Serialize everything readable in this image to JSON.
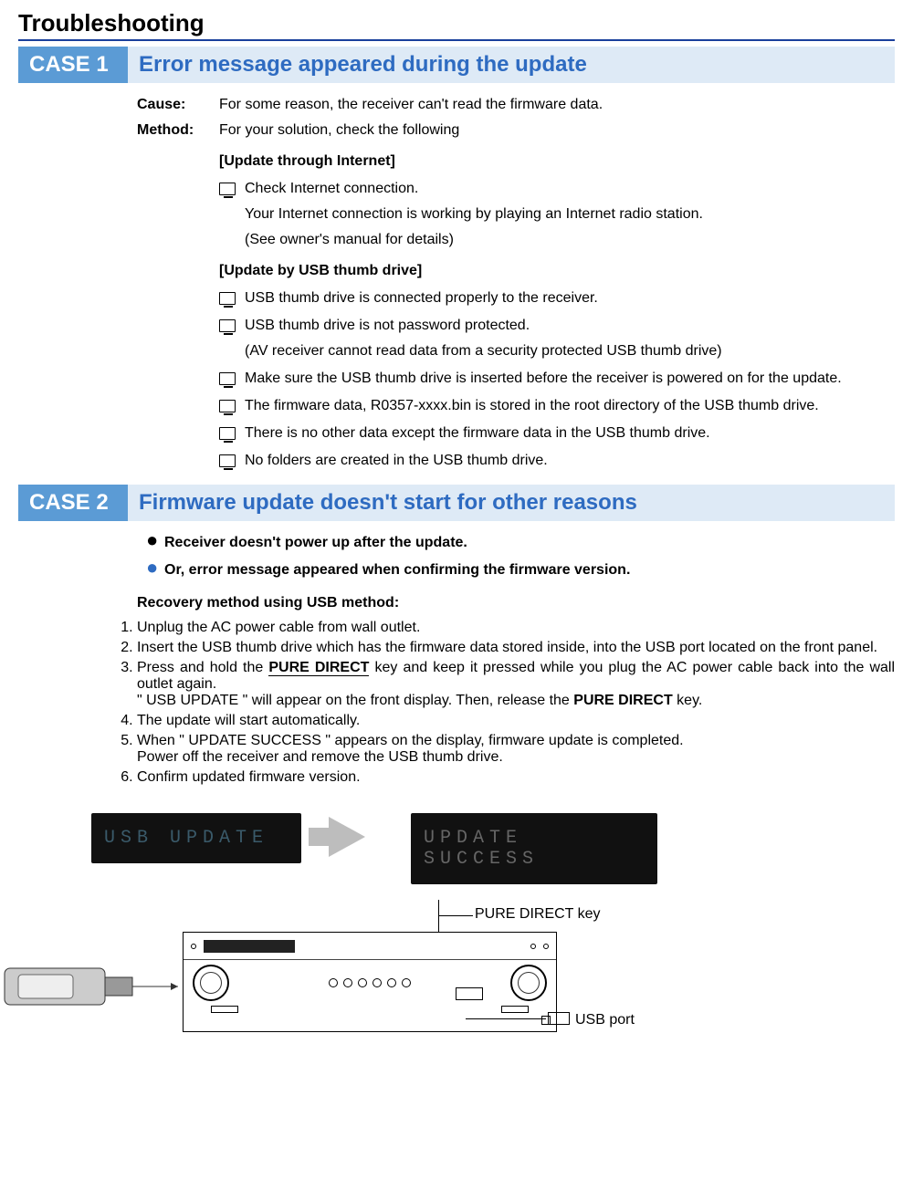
{
  "title": "Troubleshooting",
  "case1": {
    "badge": "CASE 1",
    "title": "Error message appeared during the update",
    "cause_label": "Cause:",
    "cause_text": "For some reason, the receiver can't read the firmware data.",
    "method_label": "Method:",
    "method_text": "For your solution, check the following",
    "internet_head": "[Update through Internet]",
    "internet_item1": "Check Internet connection.",
    "internet_note1": "Your Internet connection is working by playing an Internet radio station.",
    "internet_note2": "(See owner's manual for details)",
    "usb_head": "[Update by USB thumb drive]",
    "usb_item1": "USB thumb drive is connected properly to the receiver.",
    "usb_item2": "USB thumb drive is not password protected.",
    "usb_note1": "(AV receiver cannot read data from a security protected USB thumb drive)",
    "usb_item3": "Make sure the USB thumb drive is inserted before the receiver is powered on for the update.",
    "usb_item4": "The firmware data, R0357-xxxx.bin is stored in the root directory of the USB thumb drive.",
    "usb_item5": "There is no other data except the firmware data in the USB thumb drive.",
    "usb_item6": "No folders are created in the USB thumb drive."
  },
  "case2": {
    "badge": "CASE 2",
    "title": "Firmware update doesn't start for other reasons",
    "bullet1": "Receiver doesn't power up after the update.",
    "bullet2": "Or, error message appeared when confirming the firmware version.",
    "recovery_head": "Recovery method using USB method:",
    "steps": {
      "s1": "Unplug the AC power cable from wall outlet.",
      "s2": "Insert the USB thumb drive which has the firmware data stored inside, into the USB port located on the front panel.",
      "s3a": "Press and hold the ",
      "s3_key": "PURE DIRECT",
      "s3b": " key and keep it pressed while you plug the AC power cable back into the wall outlet again.",
      "s3c": "\" USB UPDATE \" will appear on the front display. Then, release the ",
      "s3_key2": "PURE DIRECT",
      "s3d": " key.",
      "s4": "The update will start automatically.",
      "s5a": "When \" UPDATE SUCCESS \" appears on the display, firmware update is completed.",
      "s5b": "Power off the receiver and remove the USB thumb drive.",
      "s6": "Confirm updated firmware version."
    }
  },
  "diagram": {
    "lcd1": "USB UPDATE",
    "lcd2": "UPDATE SUCCESS",
    "pd_label": "PURE DIRECT key",
    "usb_label": "USB port"
  }
}
